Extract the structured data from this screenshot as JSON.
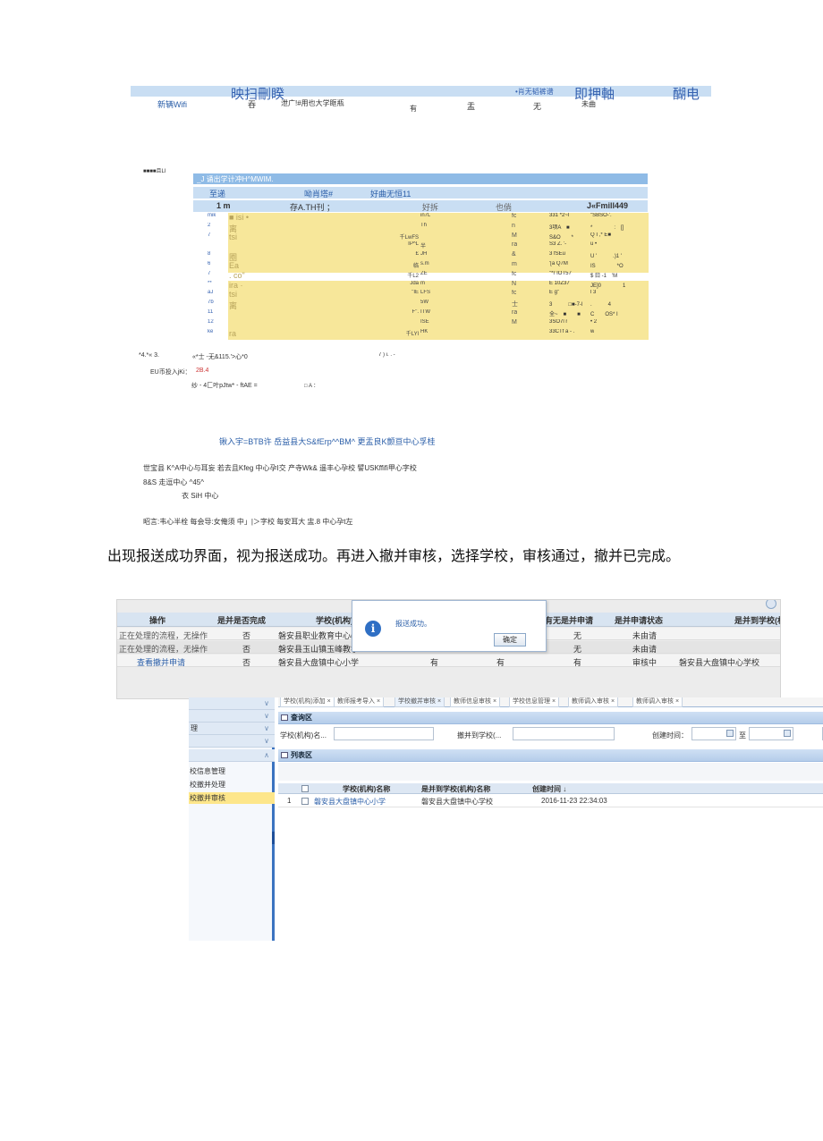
{
  "shot1": {
    "bar_labels": [
      "映扫刪睽",
      "•肖无韬裤谱",
      "即押軸",
      "醐电"
    ],
    "row": [
      "新辆Wifi",
      "吞",
      "泄广!#用也大学眶瓶",
      "有",
      "盂",
      "无",
      "未曲"
    ]
  },
  "shot2": {
    "caption": "■■■■且LI",
    "header": "_J 诵出学计冲H^MWIM.",
    "sub_row": [
      "至递",
      "呦肖塔#",
      "好曲无恒11"
    ],
    "col_row": [
      "1 m",
      "存A.TH刊 ；",
      "好拆",
      "也倘",
      "J«Fmill449"
    ],
    "left_nums": [
      "mik",
      "2",
      "7",
      "",
      "8",
      "6",
      "7",
      "**",
      "aJ",
      "7b",
      "11",
      "12",
      "ke"
    ],
    "col_a": [
      "■ isi •",
      "离",
      "tsi",
      "",
      "圈",
      "Ea",
      ". co\"",
      "ira ·",
      "tsi",
      "离",
      "",
      "",
      "ra"
    ],
    "col_b_pre": [
      "",
      "",
      "千LwFS",
      "IP^L",
      "£",
      "临",
      "千L2",
      "Jda",
      "\"IE",
      "",
      "F\".",
      "",
      "千LYl"
    ],
    "col_b": [
      "in7L",
      "Th",
      "",
      "半",
      "JH",
      "s.m",
      "ZE",
      "m",
      "LFS",
      "5W",
      "ITW",
      "ISE",
      "HK"
    ],
    "col_c": [
      "fc",
      "n",
      "M",
      "ra",
      "&",
      "m",
      "fc",
      "N",
      "fc",
      "士",
      "ra",
      "M",
      ""
    ],
    "col_d": [
      "331 *2~l",
      "3项A　■",
      "S&O　　*",
      "S3 Z. '-",
      "3 fSEu",
      "'[a Q7M",
      "\"*r IOT57",
      "E 10Z37",
      "E g\"",
      "3　　　□■-7-l",
      "全~　■　　■",
      "3SO7l r",
      "33CTf a - ."
    ],
    "col_e": [
      "\"SBSO-'.",
      "*　　　　:　[]",
      "Q I ,* E■",
      "u •",
      "U '　　　.)1 '",
      "IS　　　　*O",
      "$ 曰 -1　'M",
      "JE]0　　　　1",
      "l 3",
      ".　　　4",
      "C　　OS* I",
      "• 2",
      "w"
    ],
    "foot1": [
      "*4.*« 3.",
      "«*士 -无&115.'>心*0",
      "7 ) i. . -"
    ],
    "foot2": [
      "EU币投入jKi：",
      "2B.4"
    ],
    "foot3": [
      "纱 - 4匚叶pJtw* - ftAE =",
      "□ A ："
    ]
  },
  "shot2b": {
    "line1": "锹入宇=BTB许  岳益县大S&fErp^^BM^ 更盂良K颤亘中心孚桂",
    "line2": "世宝县  K^A中心与耳妄  若去且Kfeg  中心孕I交  产寺Wk&  遥丰心孕校  譬USKffifi甲心字校",
    "line3": "8&S 走逗中心 ^45^",
    "line4": "衣 SiH 中心",
    "line5": "昭言:韦心半栓  每会导:女俺须 中」|＞字校  每安耳大  盅.8  中心孕t左"
  },
  "paragraph": "出现报送成功界面，视为报送成功。再进入撤并审核，选择学校，审核通过，撤并已完成。",
  "shot3": {
    "headers": [
      "操作",
      "是并是否完成",
      "学校(机构)",
      "有无是并申请",
      "是并申请状态",
      "是并到学校(机"
    ],
    "rows": [
      [
        "正在处理的流程，无操作",
        "否",
        "磐安县职业教育中心(R",
        "",
        "",
        "无",
        "未由请",
        ""
      ],
      [
        "正在处理的流程，无操作",
        "否",
        "磐安县玉山镇玉峰教学",
        "",
        "",
        "无",
        "未由请",
        ""
      ],
      [
        "查看撤并申请",
        "否",
        "磐安县大盘镇中心小学",
        "有",
        "有",
        "有",
        "审核中",
        "磐安县大盘镇中心学校"
      ]
    ],
    "dialog": {
      "message": "报送成功。",
      "ok": "确定"
    }
  },
  "shot4": {
    "sidebar_items": [
      "校信息管理",
      "校撤并处理",
      "校撤并审核"
    ],
    "sidebar_heads": [
      "理"
    ],
    "tabs": [
      "学校(机构)添加 ×",
      "教师报考导入 ×",
      "学校撤并审核 ×",
      "教师信息审核 ×",
      "学校信息管理 ×",
      "教师调入审核 ×",
      "教师调入审核 ×"
    ],
    "query_panel": "查询区",
    "list_panel": "列表区",
    "filters": {
      "school": "学校(机构)名...",
      "target": "撤并到学校(...",
      "created": "创建时间：",
      "to": "至"
    },
    "grid_headers": [
      "学校(机构)名称",
      "是并到学校(机构)名称",
      "创建时间 ↓"
    ],
    "grid_rows": [
      [
        "1",
        "磐安县大盘镇中心小学",
        "磐安县大盘镇中心学校",
        "2016-11-23 22:34:03"
      ]
    ]
  }
}
